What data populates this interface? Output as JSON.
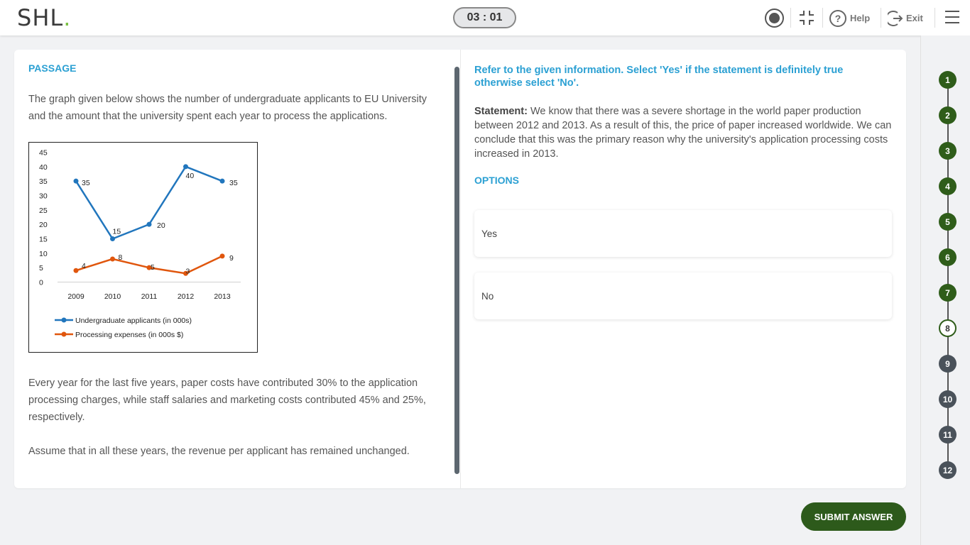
{
  "header": {
    "logo": "SHL",
    "logo_dot": ".",
    "timer": "03 : 01",
    "help_label": "Help",
    "exit_label": "Exit"
  },
  "passage": {
    "title": "PASSAGE",
    "intro": "The graph given below shows the number of undergraduate applicants to EU University and the amount that the university spent each year to process the applications.",
    "para2": "Every year for the last five years, paper costs have contributed 30% to the application processing charges, while staff salaries and marketing costs contributed 45% and 25%, respectively.",
    "para3": "Assume that in all these years, the revenue per applicant has remained unchanged."
  },
  "chart_data": {
    "type": "line",
    "categories": [
      "2009",
      "2010",
      "2011",
      "2012",
      "2013"
    ],
    "series": [
      {
        "name": "Undergraduate applicants (in 000s)",
        "values": [
          35,
          15,
          20,
          40,
          35
        ],
        "color": "#2176bd"
      },
      {
        "name": "Processing expenses (in  000s $)",
        "values": [
          4,
          8,
          5,
          3,
          9
        ],
        "color": "#e0560d"
      }
    ],
    "yticks": [
      0,
      5,
      10,
      15,
      20,
      25,
      30,
      35,
      40,
      45
    ],
    "ylim": [
      0,
      45
    ],
    "grid": false,
    "legend": "bottom-left",
    "data_labels": true
  },
  "question": {
    "instruction": "Refer to the given information. Select 'Yes' if the statement is definitely true otherwise select 'No'.",
    "statement_label": "Statement:",
    "statement_text": "We know that there was a severe shortage in the world paper production between 2012 and 2013. As a result of this, the price of paper increased worldwide. We can conclude that this was the primary reason why the university's application processing costs increased in 2013.",
    "options_title": "OPTIONS",
    "options": [
      "Yes",
      "No"
    ]
  },
  "submit_label": "SUBMIT ANSWER",
  "nav": {
    "questions": [
      {
        "n": "1",
        "state": "done"
      },
      {
        "n": "2",
        "state": "done"
      },
      {
        "n": "3",
        "state": "done"
      },
      {
        "n": "4",
        "state": "done"
      },
      {
        "n": "5",
        "state": "done"
      },
      {
        "n": "6",
        "state": "done"
      },
      {
        "n": "7",
        "state": "done"
      },
      {
        "n": "8",
        "state": "current"
      },
      {
        "n": "9",
        "state": "todo"
      },
      {
        "n": "10",
        "state": "todo"
      },
      {
        "n": "11",
        "state": "todo"
      },
      {
        "n": "12",
        "state": "todo"
      }
    ]
  }
}
